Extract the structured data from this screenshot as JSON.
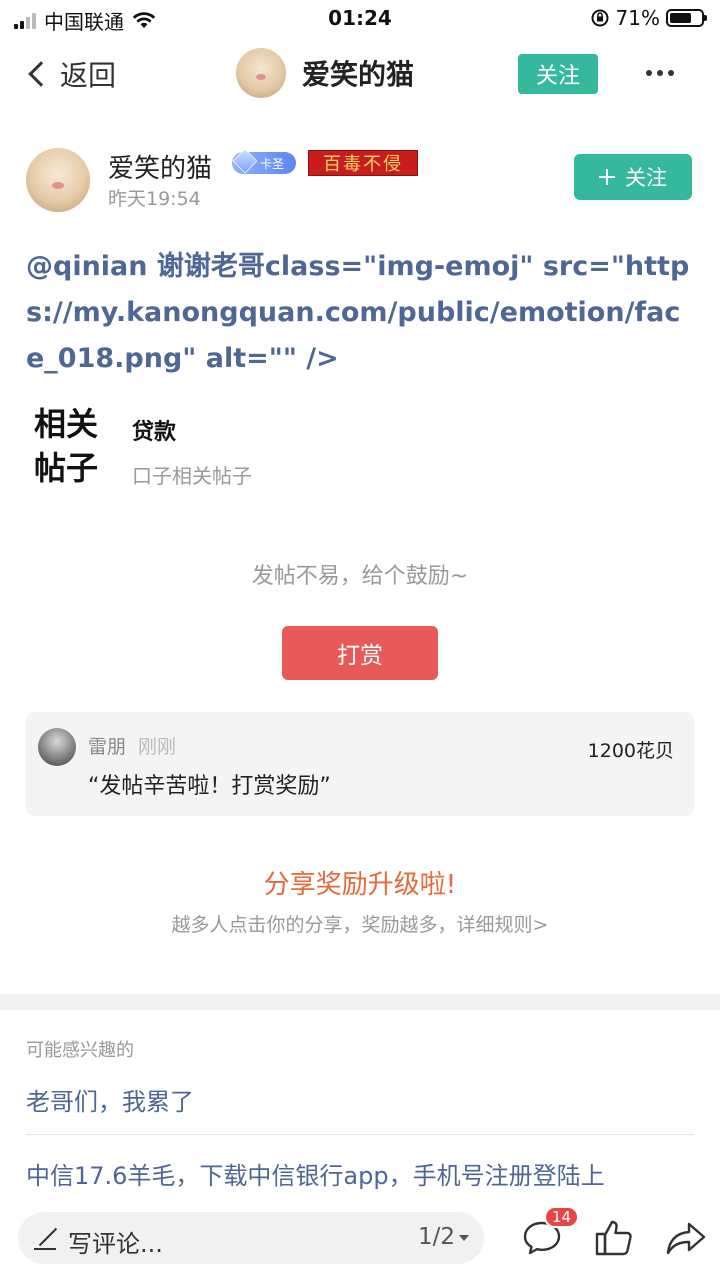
{
  "status_bar": {
    "carrier": "中国联通",
    "time": "01:24",
    "battery": "71%",
    "battery_level": 0.71
  },
  "nav": {
    "back_label": "返回",
    "title": "爱笑的猫",
    "follow_label": "关注"
  },
  "author": {
    "name": "爱笑的猫",
    "level_badge": "卡圣",
    "medal_text": "百毒不侵",
    "time": "昨天19:54",
    "follow_label": "关注"
  },
  "post": {
    "content": "@qinian  谢谢老哥class=\"img-emoj\" src=\"https://my.kanongquan.com/public/emotion/face_018.png\" alt=\"\" />"
  },
  "related": {
    "label": "相关帖子",
    "title": "贷款",
    "subtitle": "口子相关帖子"
  },
  "reward": {
    "hint": "发帖不易，给个鼓励~",
    "button_label": "打赏",
    "record": {
      "name": "雷朋",
      "time": "刚刚",
      "amount": "1200花贝",
      "message": "“发帖辛苦啦！打赏奖励”"
    }
  },
  "share": {
    "title": "分享奖励升级啦!",
    "subtitle": "越多人点击你的分享，奖励越多，详细规则>"
  },
  "interest": {
    "label": "可能感兴趣的",
    "items": [
      "老哥们，我累了",
      "中信17.6羊毛，下载中信银行app，手机号注册登陆上"
    ]
  },
  "bottom_bar": {
    "comment_placeholder": "写评论...",
    "page_indicator": "1/2",
    "comment_count": "14"
  },
  "colors": {
    "accent_green": "#35b89b",
    "reward_red": "#e85a5a",
    "link_blue": "#4f6794",
    "share_orange": "#e8683a"
  }
}
